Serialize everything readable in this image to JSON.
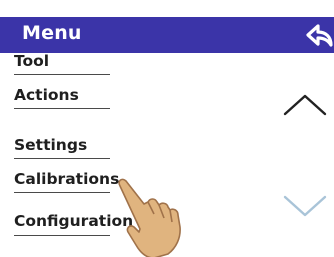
{
  "header": {
    "title": "Menu",
    "background_color": "#3b34a8",
    "back_icon": "back-arrow-icon"
  },
  "menu": {
    "items": [
      {
        "label": "Tool"
      },
      {
        "label": "Actions"
      },
      {
        "label": "Settings"
      },
      {
        "label": "Calibrations"
      },
      {
        "label": "Configuration"
      }
    ]
  },
  "scroll": {
    "up_icon": "chevron-up-icon",
    "down_icon": "chevron-down-icon",
    "up_color": "#222222",
    "down_color": "#a9c4d8"
  },
  "pointer": {
    "icon": "hand-pointer-icon"
  }
}
